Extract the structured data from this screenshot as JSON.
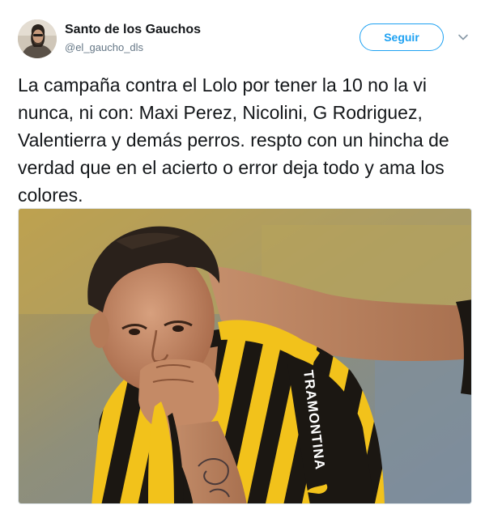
{
  "user": {
    "display_name": "Santo de los Gauchos",
    "handle": "@el_gaucho_dls",
    "avatar_icon": "user-avatar"
  },
  "actions": {
    "follow_label": "Seguir",
    "more_icon": "chevron-down-icon"
  },
  "tweet": {
    "text": "La campaña contra el Lolo por tener la 10 no la vi nunca, ni con: Maxi Perez, Nicolini, G Rodriguez, Valentierra y demás perros. respto con un hincha de verdad que en el acierto o error deja todo y ama los colores."
  },
  "media": {
    "jersey_sponsor": "TRAMONTINA"
  },
  "colors": {
    "accent": "#1da1f2",
    "text": "#14171a",
    "muted": "#657786",
    "jersey_yellow": "#f2c21b",
    "jersey_black": "#1b1712"
  }
}
